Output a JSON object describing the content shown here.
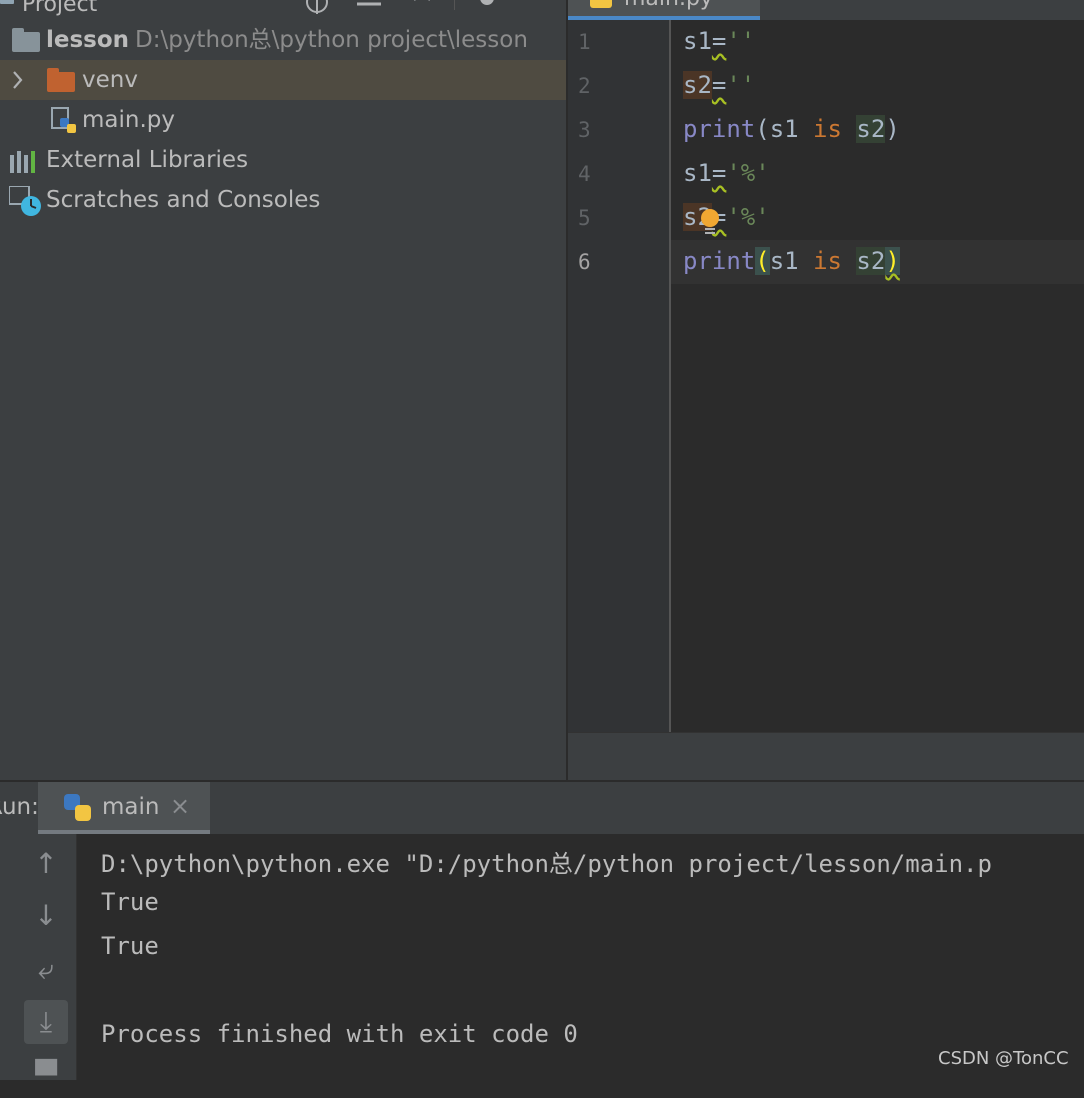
{
  "project_panel": {
    "title": "Project",
    "root": {
      "name": "lesson",
      "path": "D:\\python总\\python project\\lesson"
    },
    "items": [
      {
        "label": "venv",
        "type": "folder"
      },
      {
        "label": "main.py",
        "type": "python-file"
      },
      {
        "label": "External Libraries",
        "type": "libraries"
      },
      {
        "label": "Scratches and Consoles",
        "type": "scratches"
      }
    ]
  },
  "editor": {
    "tab_label": "main.py",
    "line_numbers": [
      "1",
      "2",
      "3",
      "4",
      "5",
      "6"
    ]
  },
  "run_panel": {
    "label": "Run:",
    "tab_label": "main",
    "output": [
      "D:\\python\\python.exe \"D:/python总/python project/lesson/main.p",
      "True",
      "True",
      "",
      "Process finished with exit code 0"
    ]
  },
  "watermark": "CSDN @TonCC",
  "colors": {
    "keyword": "#cc7832",
    "builtin": "#8888c6",
    "string": "#6a8759",
    "text": "#a9b7c6",
    "accent": "#4a88c7"
  }
}
